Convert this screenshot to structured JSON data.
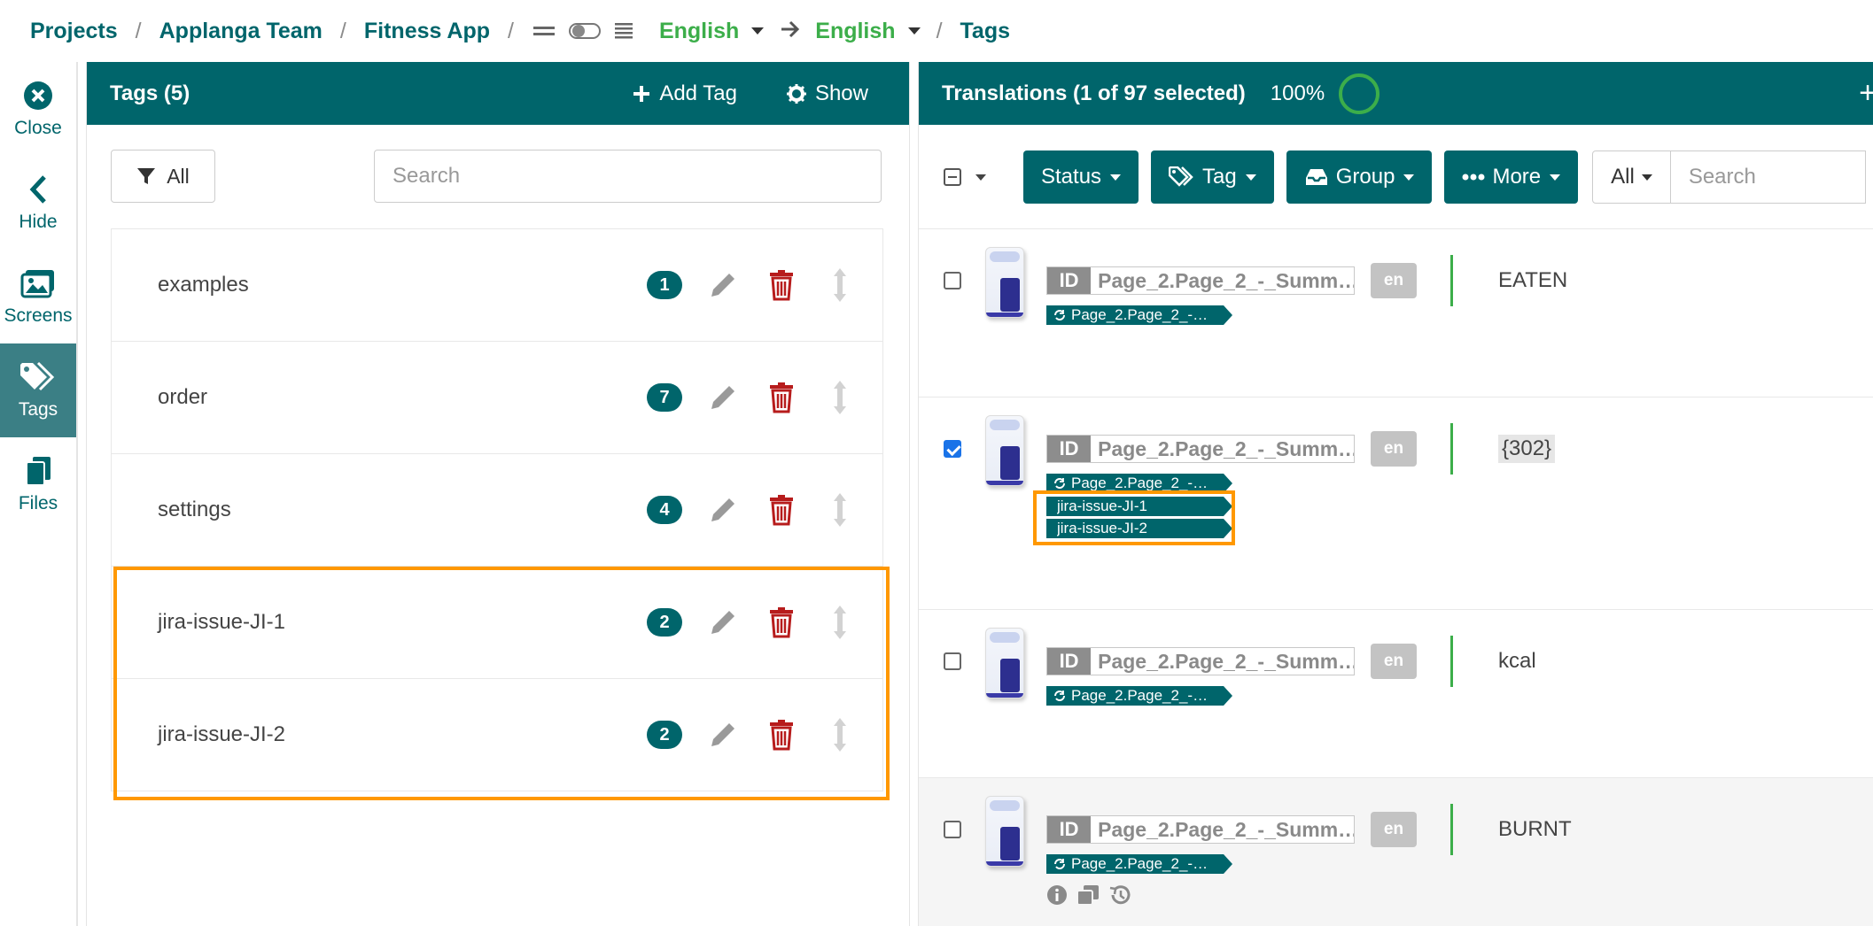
{
  "breadcrumb": {
    "items": [
      "Projects",
      "Applanga Team",
      "Fitness App"
    ],
    "source_lang": "English",
    "target_lang": "English",
    "current": "Tags"
  },
  "sidenav": [
    {
      "label": "Close",
      "icon": "close-circle-icon"
    },
    {
      "label": "Hide",
      "icon": "chevron-left-icon"
    },
    {
      "label": "Screens",
      "icon": "images-icon"
    },
    {
      "label": "Tags",
      "icon": "tags-icon"
    },
    {
      "label": "Files",
      "icon": "files-icon"
    }
  ],
  "tags_panel": {
    "title": "Tags (5)",
    "add_label": "Add Tag",
    "show_label": "Show",
    "filter_label": "All",
    "search_placeholder": "Search",
    "tags": [
      {
        "name": "examples",
        "count": "1"
      },
      {
        "name": "order",
        "count": "7"
      },
      {
        "name": "settings",
        "count": "4"
      },
      {
        "name": "jira-issue-JI-1",
        "count": "2"
      },
      {
        "name": "jira-issue-JI-2",
        "count": "2"
      }
    ]
  },
  "translations_panel": {
    "title": "Translations (1 of 97 selected)",
    "percent": "100%",
    "buttons": {
      "status": "Status",
      "tag": "Tag",
      "group": "Group",
      "more": "More"
    },
    "filter_all": "All",
    "search_placeholder": "Search",
    "rows": [
      {
        "id": "Page_2.Page_2_-_Summ…",
        "lang": "en",
        "group_tag": "Page_2.Page_2_-…",
        "value": "EATEN",
        "checked": false
      },
      {
        "id": "Page_2.Page_2_-_Summ…",
        "lang": "en",
        "group_tag": "Page_2.Page_2_-…",
        "extra_tags": [
          "jira-issue-JI-1",
          "jira-issue-JI-2"
        ],
        "value": "{302}",
        "checked": true
      },
      {
        "id": "Page_2.Page_2_-_Summ…",
        "lang": "en",
        "group_tag": "Page_2.Page_2_-…",
        "value": "kcal",
        "checked": false
      },
      {
        "id": "Page_2.Page_2_-_Summ…",
        "lang": "en",
        "group_tag": "Page_2.Page_2_-…",
        "value": "BURNT",
        "checked": false
      }
    ]
  },
  "colors": {
    "brand": "#00656b",
    "accent_green": "#3cae4a",
    "danger": "#b71c1c",
    "highlight": "#ff9800"
  }
}
